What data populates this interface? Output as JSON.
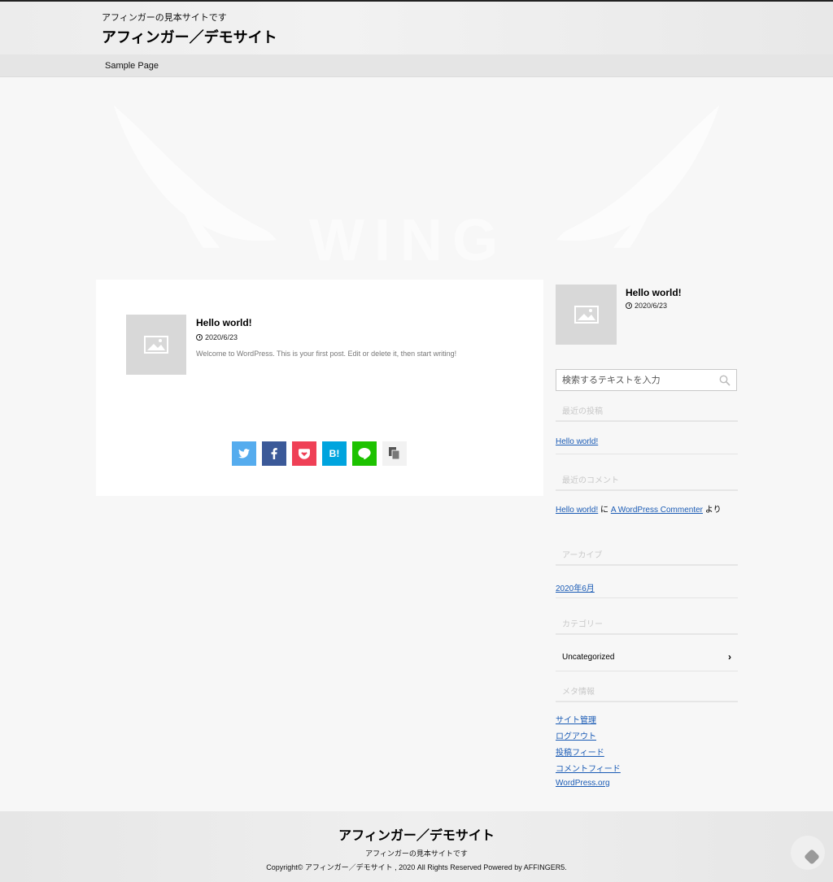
{
  "header": {
    "tagline": "アフィンガーの見本サイトです",
    "site_title": "アフィンガー／デモサイト"
  },
  "nav": {
    "items": [
      {
        "label": "Sample Page"
      }
    ]
  },
  "hero": {
    "logo_text": "WING"
  },
  "post": {
    "title": "Hello world!",
    "date": "2020/6/23",
    "excerpt": "Welcome to WordPress. This is your first post. Edit or delete it, then start writing!",
    "thumbnail_icon": "image-placeholder-icon"
  },
  "share": {
    "buttons": [
      {
        "name": "twitter",
        "icon": "twitter-icon",
        "color": "#55acee"
      },
      {
        "name": "facebook",
        "icon": "facebook-icon",
        "color": "#3b5998"
      },
      {
        "name": "pocket",
        "icon": "pocket-icon",
        "color": "#ef4056"
      },
      {
        "name": "hatena",
        "label": "B!",
        "icon": "hatena-bookmark-icon",
        "color": "#00a4de"
      },
      {
        "name": "line",
        "icon": "line-icon",
        "color": "#1dc200"
      },
      {
        "name": "copy",
        "icon": "copy-icon",
        "color": "#f2f2f2"
      }
    ]
  },
  "sidebar": {
    "recent_post": {
      "title": "Hello world!",
      "date": "2020/6/23"
    },
    "search": {
      "placeholder": "検索するテキストを入力"
    },
    "recent_posts": {
      "heading": "最近の投稿",
      "items": [
        {
          "label": "Hello world!"
        }
      ]
    },
    "recent_comments": {
      "heading": "最近のコメント",
      "post_link": "Hello world!",
      "connector": "に",
      "author_link": "A WordPress Commenter",
      "suffix": "より"
    },
    "archives": {
      "heading": "アーカイブ",
      "items": [
        {
          "label": "2020年6月"
        }
      ]
    },
    "categories": {
      "heading": "カテゴリー",
      "items": [
        {
          "label": "Uncategorized"
        }
      ]
    },
    "meta": {
      "heading": "メタ情報",
      "items": [
        {
          "label": "サイト管理"
        },
        {
          "label": "ログアウト"
        },
        {
          "label": "投稿フィード"
        },
        {
          "label": "コメントフィード"
        },
        {
          "label": "WordPress.org"
        }
      ]
    }
  },
  "footer": {
    "title": "アフィンガー／デモサイト",
    "tagline": "アフィンガーの見本サイトです",
    "copyright": "Copyright© アフィンガー／デモサイト , 2020 All  Rights Reserved Powered by AFFINGER5."
  },
  "colors": {
    "link": "#1a5bb5",
    "thumbnail_bg": "#d8d8d8",
    "page_bg": "#f7f7f7"
  }
}
